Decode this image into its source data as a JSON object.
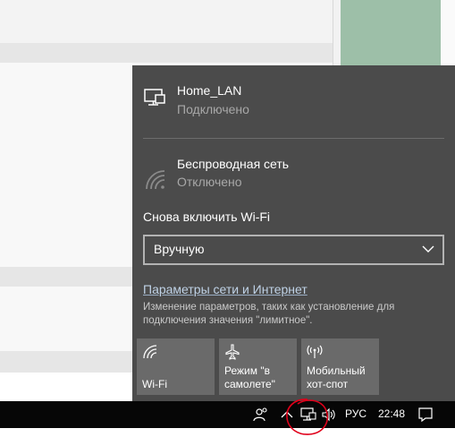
{
  "flyout": {
    "wired": {
      "name": "Home_LAN",
      "status": "Подключено",
      "icon": "ethernet-icon"
    },
    "wireless": {
      "name": "Беспроводная сеть",
      "status": "Отключено",
      "icon": "wifi-off-icon"
    },
    "reenable_label": "Снова включить Wi-Fi",
    "reenable_value": "Вручную",
    "settings_link": "Параметры сети и Интернет",
    "settings_desc": "Изменение параметров, таких как установление для подключения значения \"лимитное\".",
    "tiles": [
      {
        "label": "Wi-Fi",
        "icon": "wifi-icon",
        "active": false
      },
      {
        "label": "Режим \"в самолете\"",
        "icon": "airplane-icon",
        "active": false
      },
      {
        "label": "Мобильный хот-спот",
        "icon": "hotspot-icon",
        "active": false
      }
    ]
  },
  "taskbar": {
    "language": "РУС",
    "time": "22:48"
  },
  "colors": {
    "flyout_bg": "#4b4b4b",
    "tile_bg": "#6a6a6a",
    "link": "#bfd2e6",
    "annotation": "#e0001a"
  }
}
